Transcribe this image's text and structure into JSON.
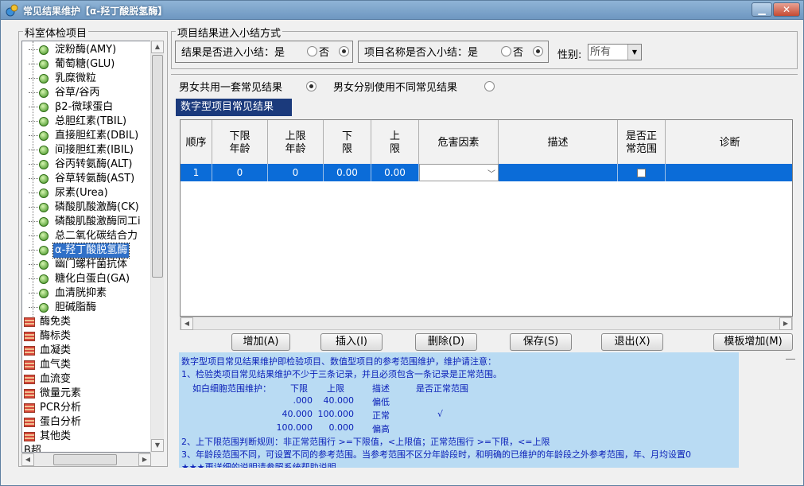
{
  "window": {
    "title": "常见结果维护【α-羟丁酸脱氢酶】",
    "min": "▁",
    "close": "✕"
  },
  "left": {
    "group_title": "科室体检项目",
    "items": [
      {
        "label": "淀粉酶(AMY)",
        "type": "leaf"
      },
      {
        "label": "葡萄糖(GLU)",
        "type": "leaf"
      },
      {
        "label": "乳糜微粒",
        "type": "leaf"
      },
      {
        "label": "谷草/谷丙",
        "type": "leaf"
      },
      {
        "label": "β2-微球蛋白",
        "type": "leaf"
      },
      {
        "label": "总胆红素(TBIL)",
        "type": "leaf"
      },
      {
        "label": "直接胆红素(DBIL)",
        "type": "leaf"
      },
      {
        "label": "间接胆红素(IBIL)",
        "type": "leaf"
      },
      {
        "label": "谷丙转氨酶(ALT)",
        "type": "leaf"
      },
      {
        "label": "谷草转氨酶(AST)",
        "type": "leaf"
      },
      {
        "label": "尿素(Urea)",
        "type": "leaf"
      },
      {
        "label": "磷酸肌酸激酶(CK)",
        "type": "leaf"
      },
      {
        "label": "磷酸肌酸激酶同工i",
        "type": "leaf"
      },
      {
        "label": "总二氧化碳结合力",
        "type": "leaf"
      },
      {
        "label": "α-羟丁酸脱氢酶",
        "type": "leaf",
        "selected": true
      },
      {
        "label": "幽门螺杆菌抗体",
        "type": "leaf"
      },
      {
        "label": "糖化白蛋白(GA)",
        "type": "leaf"
      },
      {
        "label": "血清胱抑素",
        "type": "leaf"
      },
      {
        "label": "胆碱脂酶",
        "type": "leaf"
      },
      {
        "label": "酶免类",
        "type": "folder"
      },
      {
        "label": "酶标类",
        "type": "folder"
      },
      {
        "label": "血凝类",
        "type": "folder"
      },
      {
        "label": "血气类",
        "type": "folder"
      },
      {
        "label": "血流变",
        "type": "folder"
      },
      {
        "label": "微量元素",
        "type": "folder"
      },
      {
        "label": "PCR分析",
        "type": "folder"
      },
      {
        "label": "蛋白分析",
        "type": "folder"
      },
      {
        "label": "其他类",
        "type": "folder"
      },
      {
        "label": "B超",
        "type": "root"
      }
    ]
  },
  "settings": {
    "group_title": "项目结果进入小结方式",
    "result_summary": {
      "label": "结果是否进入小结：是",
      "no": "否"
    },
    "name_summary": {
      "label": "项目名称是否入小结：是",
      "no": "否"
    },
    "gender_label": "性别:",
    "gender_value": "所有"
  },
  "mode": {
    "shared": "男女共用一套常见结果",
    "separate": "男女分别使用不同常见结果"
  },
  "section_title": "数字型项目常见结果",
  "table": {
    "headers": [
      "顺序",
      "下限年龄",
      "上限年龄",
      "下限",
      "上限",
      "危害因素",
      "描述",
      "是否正常范围",
      "诊断"
    ],
    "rows": [
      {
        "seq": "1",
        "low_age": "0",
        "high_age": "0",
        "low": "0.00",
        "high": "0.00",
        "risk": "",
        "desc": "",
        "normal": false,
        "diag": ""
      }
    ]
  },
  "buttons": {
    "add": "增加(A)",
    "insert": "插入(I)",
    "delete": "删除(D)",
    "save": "保存(S)",
    "exit": "退出(X)",
    "template": "模板增加(M)"
  },
  "notes": {
    "l1": "数字型项目常见结果维护即检验项目、数值型项目的参考范围维护，维护请注意：",
    "l2": "1、检验类项目常见结果维护不少于三条记录，并且必须包含一条记录是正常范围。",
    "ex_title": "如白细胞范围维护：",
    "ex_headers": [
      "下限",
      "上限",
      "描述",
      "是否正常范围"
    ],
    "ex_rows": [
      {
        "low": ".000",
        "high": "40.000",
        "desc": "偏低",
        "mark": ""
      },
      {
        "low": "40.000",
        "high": "100.000",
        "desc": "正常",
        "mark": "√"
      },
      {
        "low": "100.000",
        "high": "0.000",
        "desc": "偏高",
        "mark": ""
      }
    ],
    "l3": "2、上下限范围判断规则：非正常范围行 >=下限值，<上限值；正常范围行 >=下限，<=上限",
    "l4": "3、年龄段范围不同，可设置不同的参考范围。当参考范围不区分年龄段时，和明确的已维护的年龄段之外参考范围，年、月均设置0",
    "l5": "★★★更详细的说明请参照系统帮助说明"
  }
}
